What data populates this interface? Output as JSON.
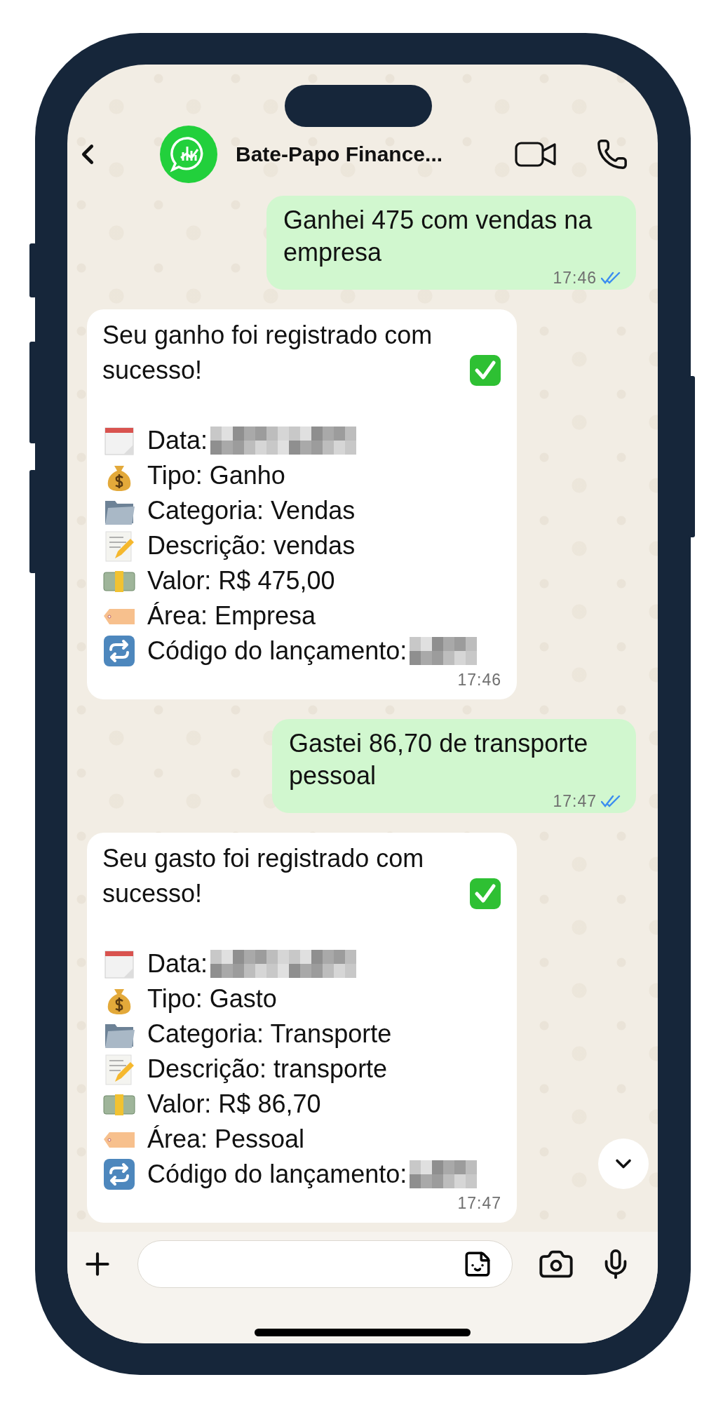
{
  "header": {
    "title": "Bate-Papo Finance..."
  },
  "messages": [
    {
      "kind": "outgoing",
      "text": "Ganhei 475 com vendas na empresa",
      "time": "17:46",
      "read": true
    },
    {
      "kind": "incoming",
      "title": "Seu ganho foi registrado com sucesso!",
      "fields": [
        {
          "kind": "calendar",
          "text": "Data:",
          "redacted": true
        },
        {
          "kind": "money-bag",
          "text": "Tipo: Ganho",
          "redacted": false
        },
        {
          "kind": "folder",
          "text": "Categoria: Vendas",
          "redacted": false
        },
        {
          "kind": "memo",
          "text": "Descrição: vendas",
          "redacted": false
        },
        {
          "kind": "banknote",
          "text": "Valor: R$ 475,00",
          "redacted": false
        },
        {
          "kind": "tag",
          "text": "Área: Empresa",
          "redacted": false
        },
        {
          "kind": "repeat",
          "text": "Código do lançamento:",
          "redacted": true
        }
      ],
      "time": "17:46"
    },
    {
      "kind": "outgoing",
      "text": "Gastei 86,70 de transporte pessoal",
      "time": "17:47",
      "read": true
    },
    {
      "kind": "incoming",
      "title": "Seu gasto foi registrado com sucesso!",
      "fields": [
        {
          "kind": "calendar",
          "text": "Data:",
          "redacted": true
        },
        {
          "kind": "money-bag",
          "text": "Tipo: Gasto",
          "redacted": false
        },
        {
          "kind": "folder",
          "text": "Categoria: Transporte",
          "redacted": false
        },
        {
          "kind": "memo",
          "text": "Descrição: transporte",
          "redacted": false
        },
        {
          "kind": "banknote",
          "text": "Valor: R$ 86,70",
          "redacted": false
        },
        {
          "kind": "tag",
          "text": "Área: Pessoal",
          "redacted": false
        },
        {
          "kind": "repeat",
          "text": "Código do lançamento:",
          "redacted": true
        }
      ],
      "time": "17:47"
    }
  ]
}
